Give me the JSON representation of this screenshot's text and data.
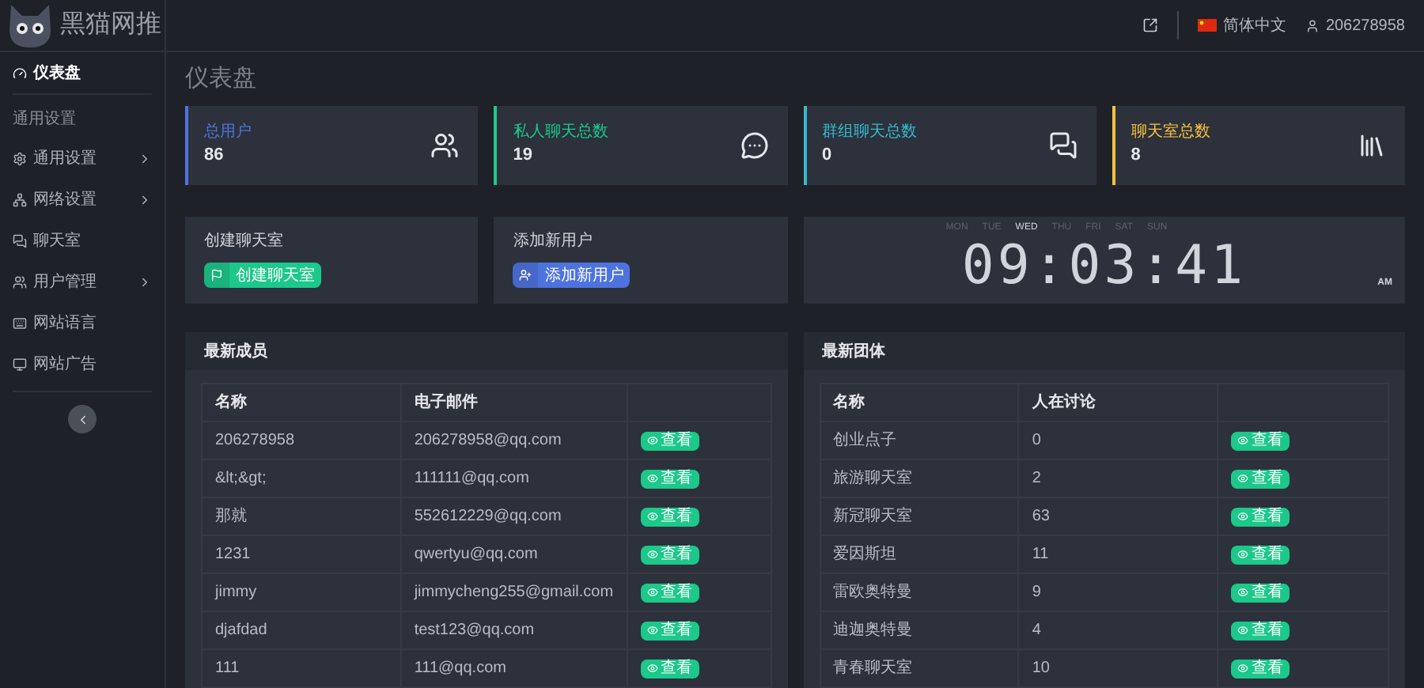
{
  "header": {
    "brand": "黑猫网推",
    "language": "简体中文",
    "username": "206278958"
  },
  "sidebar": {
    "items": [
      {
        "kind": "link",
        "label": "仪表盘",
        "selected": true,
        "expandable": false
      },
      {
        "kind": "section",
        "label": "通用设置"
      },
      {
        "kind": "link",
        "label": "通用设置",
        "selected": false,
        "expandable": true
      },
      {
        "kind": "link",
        "label": "网络设置",
        "selected": false,
        "expandable": true
      },
      {
        "kind": "link",
        "label": "聊天室",
        "selected": false,
        "expandable": false
      },
      {
        "kind": "link",
        "label": "用户管理",
        "selected": false,
        "expandable": true
      },
      {
        "kind": "link",
        "label": "网站语言",
        "selected": false,
        "expandable": false
      },
      {
        "kind": "link",
        "label": "网站广告",
        "selected": false,
        "expandable": false
      }
    ]
  },
  "page_title": "仪表盘",
  "stats": [
    {
      "label": "总用户",
      "value": "86",
      "color": "#4e73df"
    },
    {
      "label": "私人聊天总数",
      "value": "19",
      "color": "#1cc88a"
    },
    {
      "label": "群组聊天总数",
      "value": "0",
      "color": "#36b9cc"
    },
    {
      "label": "聊天室总数",
      "value": "8",
      "color": "#f6c23e"
    }
  ],
  "actions": [
    {
      "title": "创建聊天室",
      "button": "创建聊天室",
      "kind": "success"
    },
    {
      "title": "添加新用户",
      "button": "添加新用户",
      "kind": "primary"
    }
  ],
  "clock": {
    "days": [
      {
        "label": "MON",
        "selected": false
      },
      {
        "label": "TUE",
        "selected": false
      },
      {
        "label": "WED",
        "selected": true
      },
      {
        "label": "THU",
        "selected": false
      },
      {
        "label": "FRI",
        "selected": false
      },
      {
        "label": "SAT",
        "selected": false
      },
      {
        "label": "SUN",
        "selected": false
      }
    ],
    "time": "09:03:41",
    "period": "AM"
  },
  "tables": [
    {
      "title": "最新成员",
      "columns": [
        "名称",
        "电子邮件"
      ],
      "rows": [
        {
          "cells": [
            "206278958",
            "206278958@qq.com"
          ],
          "action": "查看"
        },
        {
          "cells": [
            "&lt;&gt;",
            "111111@qq.com"
          ],
          "action": "查看"
        },
        {
          "cells": [
            "那就",
            "552612229@qq.com"
          ],
          "action": "查看"
        },
        {
          "cells": [
            "1231",
            "qwertyu@qq.com"
          ],
          "action": "查看"
        },
        {
          "cells": [
            "jimmy",
            "jimmycheng255@gmail.com"
          ],
          "action": "查看"
        },
        {
          "cells": [
            "djafdad",
            "test123@qq.com"
          ],
          "action": "查看"
        },
        {
          "cells": [
            "111",
            "111@qq.com"
          ],
          "action": "查看"
        }
      ]
    },
    {
      "title": "最新团体",
      "columns": [
        "名称",
        "人在讨论"
      ],
      "rows": [
        {
          "cells": [
            "创业点子",
            "0"
          ],
          "action": "查看"
        },
        {
          "cells": [
            "旅游聊天室",
            "2"
          ],
          "action": "查看"
        },
        {
          "cells": [
            "新冠聊天室",
            "63"
          ],
          "action": "查看"
        },
        {
          "cells": [
            "爱因斯坦",
            "11"
          ],
          "action": "查看"
        },
        {
          "cells": [
            "雷欧奥特曼",
            "9"
          ],
          "action": "查看"
        },
        {
          "cells": [
            "迪迦奥特曼",
            "4"
          ],
          "action": "查看"
        },
        {
          "cells": [
            "青春聊天室",
            "10"
          ],
          "action": "查看"
        }
      ]
    }
  ]
}
